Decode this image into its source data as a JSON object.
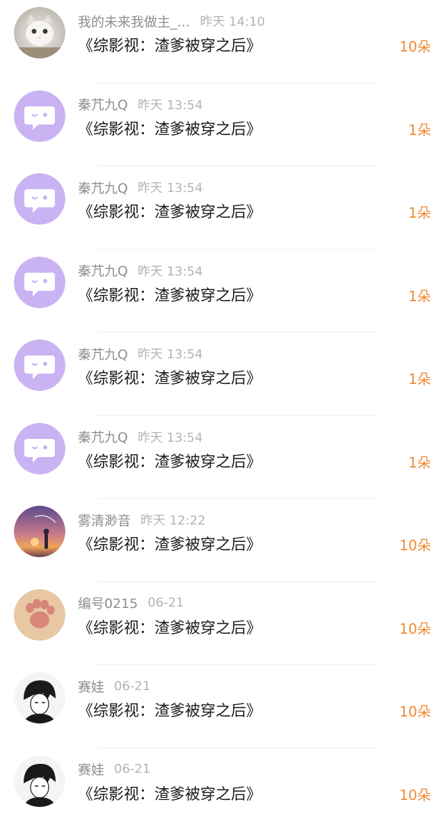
{
  "items": [
    {
      "name": "我的未来我做主_…",
      "time": "昨天 14:10",
      "title": "《综影视：渣爹被穿之后》",
      "count": "10朵",
      "avatar": "cat-photo-avatar"
    },
    {
      "name": "秦芁九Q",
      "time": "昨天 13:54",
      "title": "《综影视：渣爹被穿之后》",
      "count": "1朵",
      "avatar": "default-chat-bubble-avatar"
    },
    {
      "name": "秦芁九Q",
      "time": "昨天 13:54",
      "title": "《综影视：渣爹被穿之后》",
      "count": "1朵",
      "avatar": "default-chat-bubble-avatar"
    },
    {
      "name": "秦芁九Q",
      "time": "昨天 13:54",
      "title": "《综影视：渣爹被穿之后》",
      "count": "1朵",
      "avatar": "default-chat-bubble-avatar"
    },
    {
      "name": "秦芁九Q",
      "time": "昨天 13:54",
      "title": "《综影视：渣爹被穿之后》",
      "count": "1朵",
      "avatar": "default-chat-bubble-avatar"
    },
    {
      "name": "秦芁九Q",
      "time": "昨天 13:54",
      "title": "《综影视：渣爹被穿之后》",
      "count": "1朵",
      "avatar": "default-chat-bubble-avatar"
    },
    {
      "name": "雾清渺音",
      "time": "昨天 12:22",
      "title": "《综影视：渣爹被穿之后》",
      "count": "10朵",
      "avatar": "sunset-umbrella-avatar"
    },
    {
      "name": "编号0215",
      "time": "06-21",
      "title": "《综影视：渣爹被穿之后》",
      "count": "10朵",
      "avatar": "cat-paw-avatar"
    },
    {
      "name": "赛娃",
      "time": "06-21",
      "title": "《综影视：渣爹被穿之后》",
      "count": "10朵",
      "avatar": "manga-character-avatar"
    },
    {
      "name": "赛娃",
      "time": "06-21",
      "title": "《综影视：渣爹被穿之后》",
      "count": "10朵",
      "avatar": "manga-character-avatar"
    }
  ],
  "colors": {
    "count": "#f08a32",
    "name": "#8e8e8e",
    "time": "#b4b4b4",
    "title": "#1c1c1c",
    "default_avatar": "#c9b3f2"
  }
}
